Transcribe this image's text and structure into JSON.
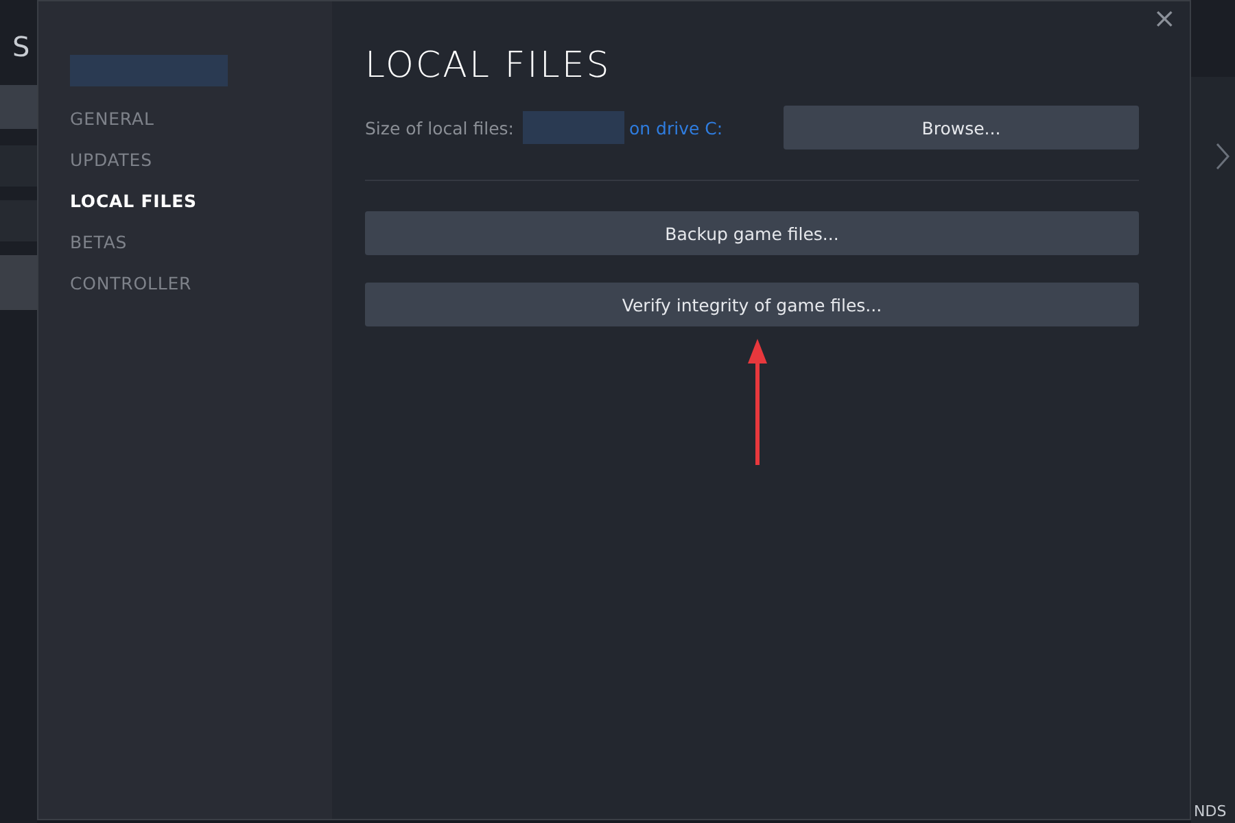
{
  "background_window": {
    "title_fragment": "S",
    "corner_fragment": "NDS"
  },
  "sidebar": {
    "items": [
      {
        "label": "GENERAL",
        "selected": false
      },
      {
        "label": "UPDATES",
        "selected": false
      },
      {
        "label": "LOCAL FILES",
        "selected": true
      },
      {
        "label": "BETAS",
        "selected": false
      },
      {
        "label": "CONTROLLER",
        "selected": false
      }
    ]
  },
  "content": {
    "title": "LOCAL FILES",
    "size_label": "Size of local files:",
    "drive_link": "on drive C:",
    "browse_button": "Browse...",
    "buttons": [
      "Backup game files...",
      "Verify integrity of game files..."
    ]
  },
  "close_button": "×"
}
